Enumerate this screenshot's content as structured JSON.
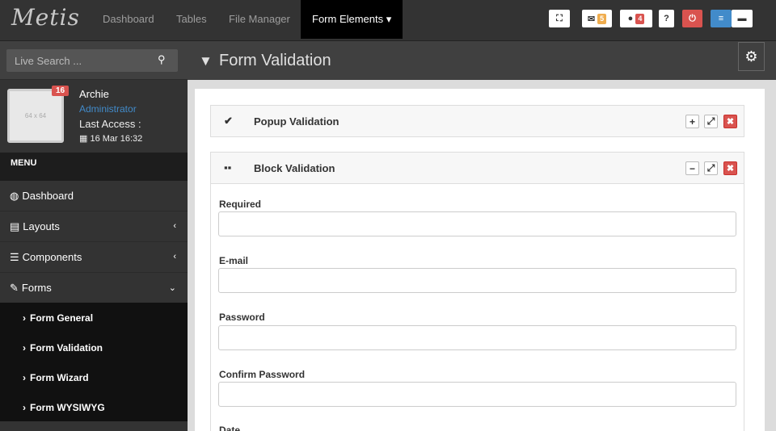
{
  "brand": "Metis",
  "nav": [
    "Dashboard",
    "Tables",
    "File Manager"
  ],
  "nav_active": "Form Elements",
  "topbar_badges": {
    "mail": "5",
    "comments": "4"
  },
  "search": {
    "placeholder": "Live Search ..."
  },
  "user": {
    "avatar_placeholder": "64 x 64",
    "notifications": "16",
    "name": "Archie",
    "role": "Administrator",
    "last_access_label": "Last Access :",
    "last_access_date": "16 Mar 16:32"
  },
  "menu": {
    "header": "MENU",
    "items": [
      "Dashboard",
      "Layouts",
      "Components",
      "Forms"
    ],
    "forms_sub": [
      "Form General",
      "Form Validation",
      "Form Wizard",
      "Form WYSIWYG"
    ]
  },
  "page": {
    "title": "Form Validation"
  },
  "panels": {
    "popup": "Popup Validation",
    "block": "Block Validation"
  },
  "fields": [
    "Required",
    "E-mail",
    "Password",
    "Confirm Password",
    "Date"
  ],
  "colors": {
    "topbar": "#333333",
    "danger": "#d9534f",
    "primary": "#428bca",
    "warning": "#f0ad4e"
  }
}
